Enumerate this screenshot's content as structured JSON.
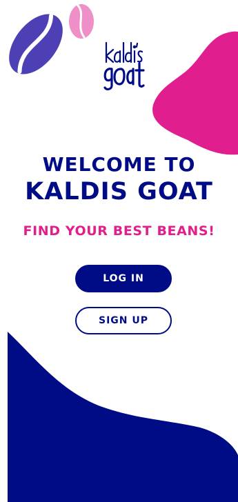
{
  "brand": {
    "logo_text": "kaldi's goat",
    "welcome": "WELCOME TO",
    "name": "KALDIS GOAT",
    "tagline": "FIND YOUR BEST BEANS!"
  },
  "actions": {
    "login_label": "LOG IN",
    "signup_label": "SIGN UP"
  },
  "colors": {
    "primary_navy": "#000c85",
    "accent_pink": "#e11e8d",
    "bean_purple": "#4d40b5",
    "bean_pink": "#ef8fc7",
    "background": "#ffffff"
  },
  "decorations": {
    "icons": [
      "coffee-bean-icon",
      "coffee-bean-small-icon",
      "pink-blob-shape",
      "navy-wave-shape"
    ]
  }
}
